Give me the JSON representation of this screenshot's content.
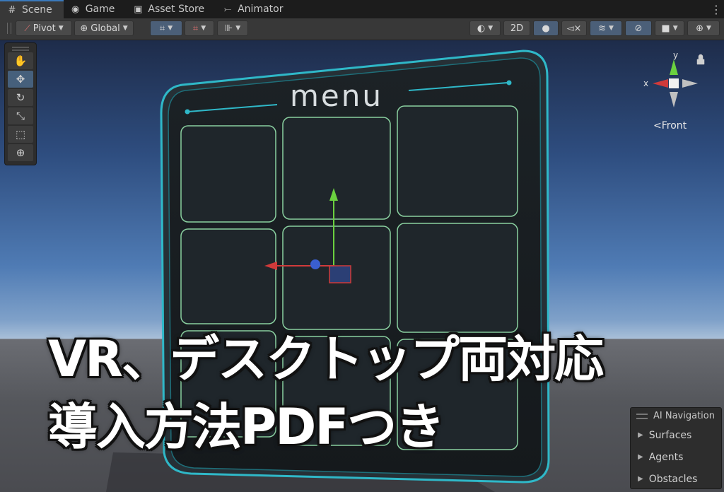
{
  "tabs": [
    {
      "label": "Scene",
      "icon": "grid-icon",
      "active": true
    },
    {
      "label": "Game",
      "icon": "gamepad-icon",
      "active": false
    },
    {
      "label": "Asset Store",
      "icon": "shopping-bag-icon",
      "active": false
    },
    {
      "label": "Animator",
      "icon": "animator-icon",
      "active": false
    }
  ],
  "toolbar": {
    "pivot_label": "Pivot",
    "global_label": "Global",
    "mode_2d_label": "2D"
  },
  "gizmo": {
    "axis_y": "y",
    "axis_x": "x",
    "view_label": "<Front"
  },
  "menu_panel": {
    "title": "menu"
  },
  "overlay_text": {
    "line1": "VR、デスクトップ両対応",
    "line2": "導入方法PDFつき"
  },
  "ai_navigation": {
    "title": "AI Navigation",
    "items": [
      "Surfaces",
      "Agents",
      "Obstacles"
    ]
  },
  "colors": {
    "panel_accent": "#2fb8c8",
    "active_tab_border": "#3a79bb",
    "gizmo_x": "#d03a3a",
    "gizmo_y": "#6bd13f",
    "gizmo_z": "#3a5fd0"
  }
}
